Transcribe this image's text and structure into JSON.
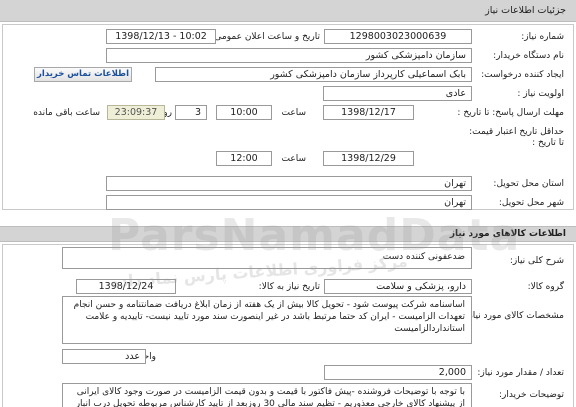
{
  "header": {
    "title": "جزئیات اطلاعات نیاز"
  },
  "need": {
    "need_number_label": "شماره نیاز:",
    "need_number": "1298003023000639",
    "announce_label": "تاریخ و ساعت اعلان عمومی:",
    "announce_value": "1398/12/13 - 10:02",
    "buyer_label": "نام دستگاه خریدار:",
    "buyer_value": "سازمان دامپزشکی کشور",
    "creator_label": "ایجاد کننده درخواست:",
    "creator_value": "بابک اسماعیلی کارپرداز سازمان دامپزشکی کشور",
    "contact_button": "اطلاعات تماس خریدار",
    "priority_label": "اولویت نیاز :",
    "priority_value": "عادی",
    "deadline_label": "مهلت ارسال پاسخ: تا تاریخ :",
    "deadline_date": "1398/12/17",
    "time_label": "ساعت",
    "deadline_time": "10:00",
    "days_value": "3",
    "days_label": "روز و",
    "countdown": "23:09:37",
    "remaining_label": "ساعت باقی مانده",
    "min_validity_label": "حداقل تاریخ اعتبار قیمت: تا تاریخ :",
    "validity_date": "1398/12/29",
    "validity_time_label": "ساعت",
    "validity_time": "12:00",
    "province_label": "استان محل تحویل:",
    "province_value": "تهران",
    "city_label": "شهر محل تحویل:",
    "city_value": "تهران"
  },
  "goods": {
    "section_title": "اطلاعات کالاهای مورد نیاز",
    "summary_label": "شرح کلی نیاز:",
    "summary_value": "ضدعفونی کننده دست",
    "group_label": "گروه کالا:",
    "group_value": "دارو، پزشکی و سلامت",
    "need_date_label": "تاریخ نیاز به کالا:",
    "need_date_value": "1398/12/24",
    "specs_label": "مشخصات کالای مورد نیاز:",
    "specs_value": "اساسنامه شرکت پیوست شود - تحویل کالا بیش از یک هفته از زمان ابلاغ دریافت ضمانتنامه و حسن انجام تعهدات الزامیست - ایران کد حتما مرتبط باشد در غیر اینصورت سند مورد تایید نیست- تاییدیه و علامت استانداردالزامیست",
    "unit_label": "واحد شمارش:",
    "unit_value": "عدد",
    "quantity_label": "تعداد / مقدار مورد نیاز:",
    "quantity_value": "2,000",
    "notes_label": "توضیحات خریدار:",
    "notes_value": "با توجه با توضیحات فروشنده -پیش فاکتور با قیمت و بدون قیمت الزامیست در صورت وجود کالای ایرانی از پیشنهاد کالای خارجی معذوریم - تظیم سند مالی 30 روزبعد از تایید کارشناس مربوطه تحویل درب انبار سازمان واقع در اتوبان کرج"
  },
  "watermark": {
    "brand": "ParsNamadData",
    "tagline": "مرکز فراوری اطلاعات پارس نماد داده"
  }
}
